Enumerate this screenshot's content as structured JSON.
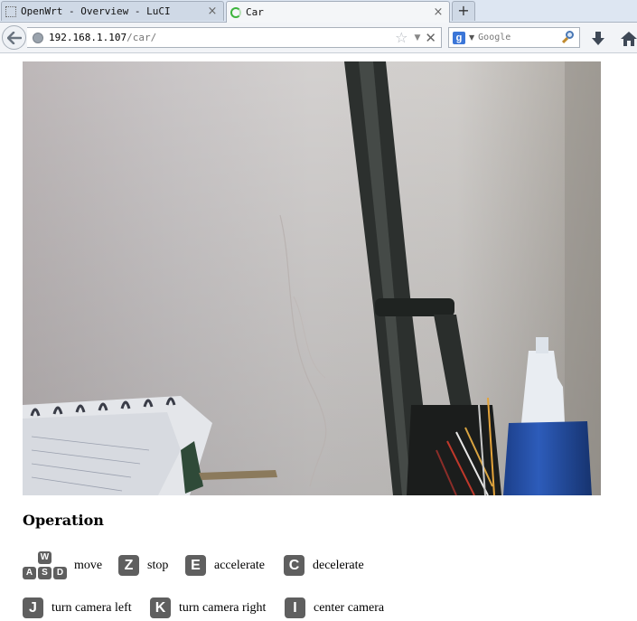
{
  "browser": {
    "tabs": [
      {
        "title": "OpenWrt - Overview - LuCI",
        "active": false
      },
      {
        "title": "Car",
        "active": true
      }
    ],
    "url_host": "192.168.1.107",
    "url_path": "/car/",
    "search_placeholder": "Google",
    "search_engine_letter": "g"
  },
  "page": {
    "operation_heading": "Operation",
    "controls": [
      {
        "keys": [
          "W",
          "A",
          "S",
          "D"
        ],
        "label": "move"
      },
      {
        "key": "Z",
        "label": "stop"
      },
      {
        "key": "E",
        "label": "accelerate"
      },
      {
        "key": "C",
        "label": "decelerate"
      },
      {
        "key": "J",
        "label": "turn camera left"
      },
      {
        "key": "K",
        "label": "turn camera right"
      },
      {
        "key": "I",
        "label": "center camera"
      }
    ]
  },
  "colors": {
    "key_background": "#5f5f5f",
    "tab_active_background": "#f4f6f8",
    "tab_strip_background": "#dde6f2"
  },
  "icons": [
    "back-arrow-icon",
    "globe-icon",
    "bookmark-star-icon",
    "dropdown-arrow-icon",
    "stop-icon",
    "search-engine-icon",
    "search-icon",
    "downloads-icon",
    "home-icon",
    "close-icon",
    "plus-icon",
    "loading-icon"
  ]
}
